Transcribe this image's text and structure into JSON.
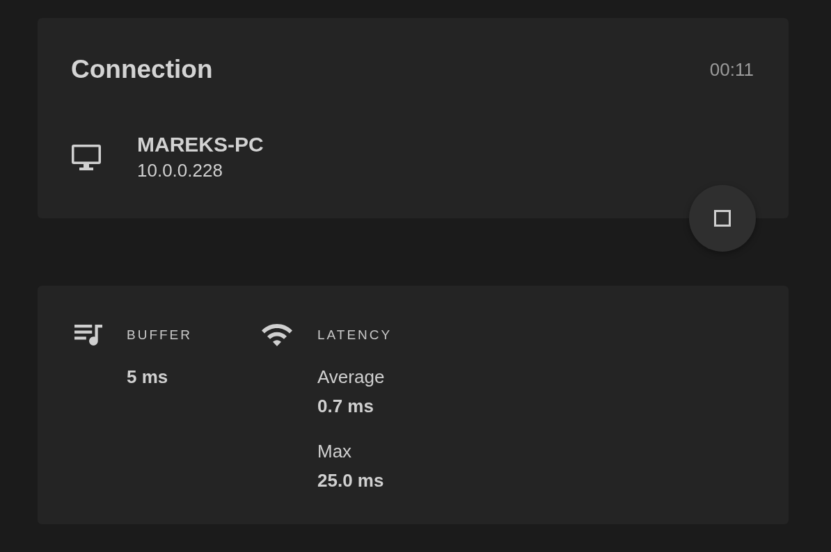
{
  "connection": {
    "title": "Connection",
    "elapsed": "00:11",
    "device": {
      "name": "MAREKS-PC",
      "address": "10.0.0.228"
    }
  },
  "stats": [
    {
      "kind": "buffer",
      "label": "BUFFER",
      "values": [
        {
          "value": "5 ms"
        }
      ]
    },
    {
      "kind": "latency",
      "label": "LATENCY",
      "values": [
        {
          "label": "Average",
          "value": "0.7 ms"
        },
        {
          "label": "Max",
          "value": "25.0 ms"
        }
      ]
    }
  ]
}
